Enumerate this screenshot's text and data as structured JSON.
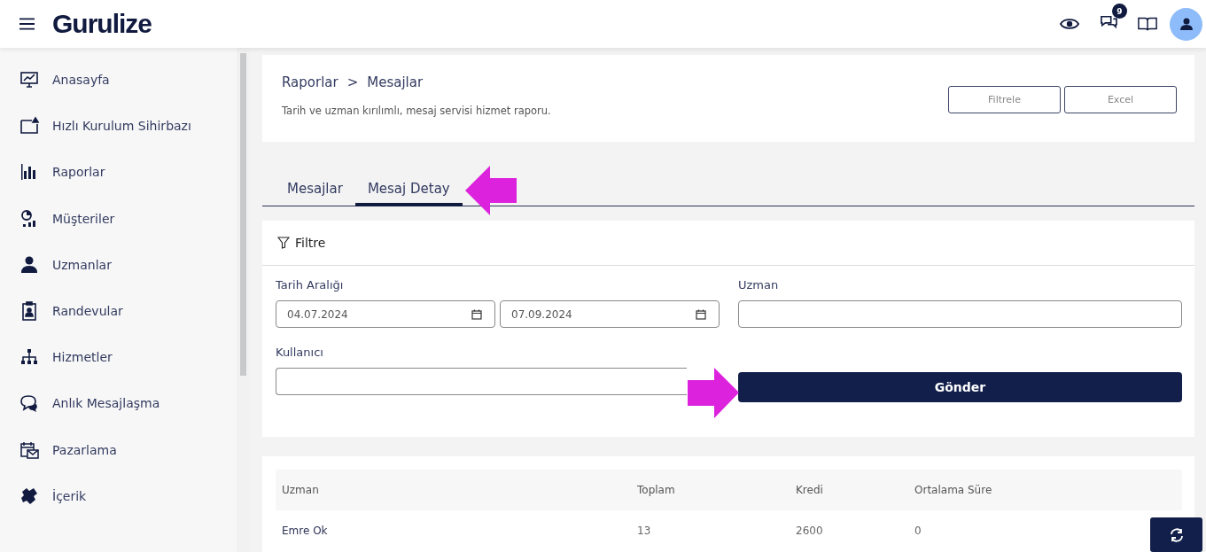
{
  "header": {
    "logo": "Gurulize",
    "notification_count": "9"
  },
  "sidebar": {
    "items": [
      {
        "label": "Anasayfa",
        "kind": "monitor"
      },
      {
        "label": "Hızlı Kurulum Sihirbazı",
        "kind": "wizard"
      },
      {
        "label": "Raporlar",
        "kind": "bars"
      },
      {
        "label": "Müşteriler",
        "kind": "pie"
      },
      {
        "label": "Uzmanlar",
        "kind": "person"
      },
      {
        "label": "Randevular",
        "kind": "clipboard"
      },
      {
        "label": "Hizmetler",
        "kind": "tree"
      },
      {
        "label": "Anlık Mesajlaşma",
        "kind": "chat"
      },
      {
        "label": "Pazarlama",
        "kind": "mail"
      },
      {
        "label": "İçerik",
        "kind": "puzzle"
      }
    ]
  },
  "page_header": {
    "breadcrumb": [
      "Raporlar",
      "Mesajlar"
    ],
    "separator": ">",
    "description": "Tarih ve uzman kırılımlı, mesaj servisi hizmet raporu.",
    "buttons": [
      "Filtrele",
      "Excel"
    ]
  },
  "tabs": [
    {
      "label": "Mesajlar",
      "selected": false
    },
    {
      "label": "Mesaj Detay",
      "selected": true
    }
  ],
  "filter": {
    "title": "Filtre",
    "date_label": "Tarih Aralığı",
    "date_from": "04.07.2024",
    "date_to": "07.09.2024",
    "expert_label": "Uzman",
    "user_label": "Kullanıcı",
    "submit": "Gönder"
  },
  "table": {
    "columns": [
      "Uzman",
      "Toplam",
      "Kredi",
      "Ortalama Süre"
    ],
    "rows": [
      [
        "Emre Ok",
        "13",
        "2600",
        "0"
      ]
    ]
  }
}
